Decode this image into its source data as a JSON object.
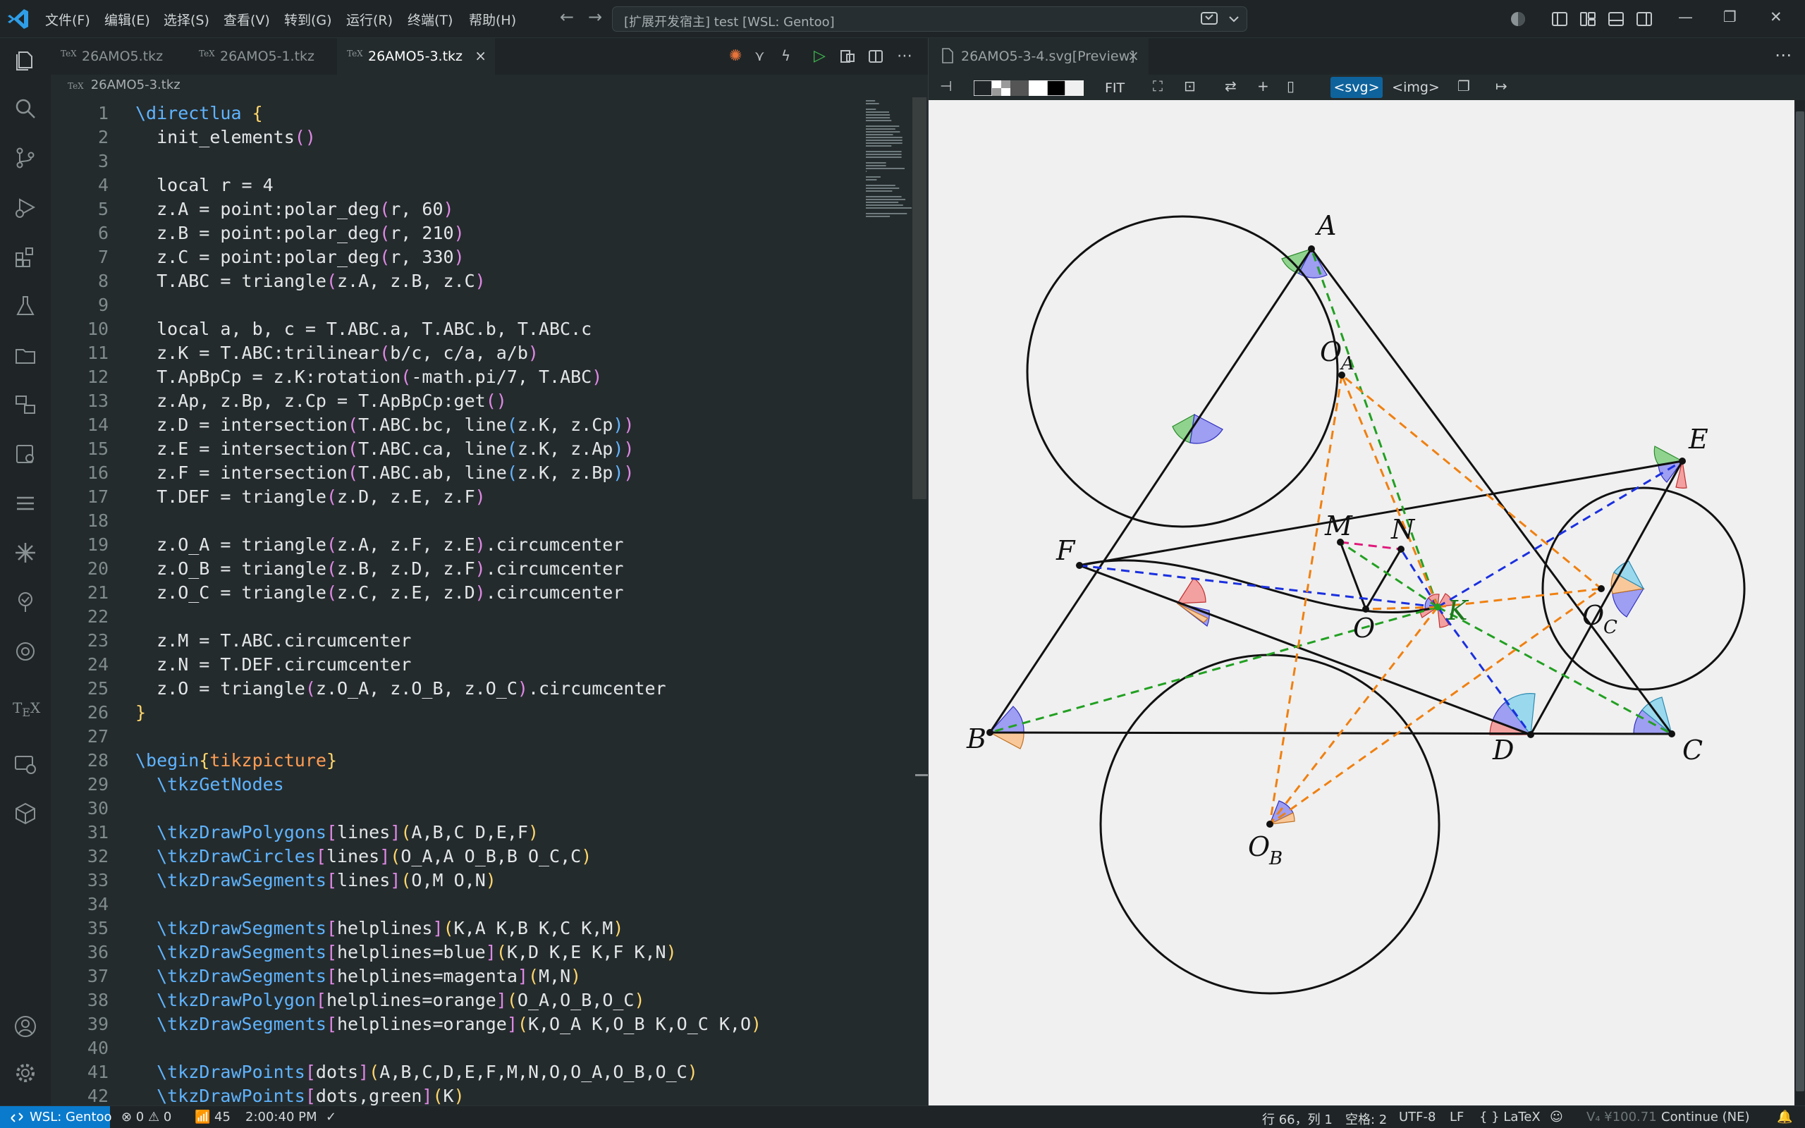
{
  "titlebar": {
    "menus": [
      "文件(F)",
      "编辑(E)",
      "选择(S)",
      "查看(V)",
      "转到(G)",
      "运行(R)",
      "终端(T)",
      "帮助(H)"
    ],
    "command_center": "[扩展开发宿主] test [WSL: Gentoo]"
  },
  "editor": {
    "tabs": [
      {
        "label": "26AMO5.tkz",
        "icon": "tex-file-icon"
      },
      {
        "label": "26AMO5-1.tkz",
        "icon": "tex-file-icon"
      },
      {
        "label": "26AMO5-3.tkz",
        "icon": "tex-file-icon",
        "active": true
      }
    ],
    "tab_icon_text": "TeX",
    "close_glyph": "×",
    "breadcrumb": "26AMO5-3.tkz",
    "lines": [
      {
        "n": "1",
        "html": "<span class=\"kw\">\\directlua</span> <span class=\"br1\">{</span>"
      },
      {
        "n": "2",
        "html": "  init_elements<span class=\"br2\">()</span>"
      },
      {
        "n": "3",
        "html": ""
      },
      {
        "n": "4",
        "html": "  local r = 4"
      },
      {
        "n": "5",
        "html": "  z.A = point:polar_deg<span class=\"br2\">(</span>r, 60<span class=\"br2\">)</span>"
      },
      {
        "n": "6",
        "html": "  z.B = point:polar_deg<span class=\"br2\">(</span>r, 210<span class=\"br2\">)</span>"
      },
      {
        "n": "7",
        "html": "  z.C = point:polar_deg<span class=\"br2\">(</span>r, 330<span class=\"br2\">)</span>"
      },
      {
        "n": "8",
        "html": "  T.ABC = triangle<span class=\"br2\">(</span>z.A, z.B, z.C<span class=\"br2\">)</span>"
      },
      {
        "n": "9",
        "html": ""
      },
      {
        "n": "10",
        "html": "  local a, b, c = T.ABC.a, T.ABC.b, T.ABC.c"
      },
      {
        "n": "11",
        "html": "  z.K = T.ABC:trilinear<span class=\"br2\">(</span>b/c, c/a, a/b<span class=\"br2\">)</span>"
      },
      {
        "n": "12",
        "html": "  T.ApBpCp = z.K:rotation<span class=\"br2\">(</span>-math.pi/7, T.ABC<span class=\"br2\">)</span>"
      },
      {
        "n": "13",
        "html": "  z.Ap, z.Bp, z.Cp = T.ApBpCp:get<span class=\"br2\">()</span>"
      },
      {
        "n": "14",
        "html": "  z.D = intersection<span class=\"br2\">(</span>T.ABC.bc, line<span class=\"br3\">(</span>z.K, z.Cp<span class=\"br3\">)</span><span class=\"br2\">)</span>"
      },
      {
        "n": "15",
        "html": "  z.E = intersection<span class=\"br2\">(</span>T.ABC.ca, line<span class=\"br3\">(</span>z.K, z.Ap<span class=\"br3\">)</span><span class=\"br2\">)</span>"
      },
      {
        "n": "16",
        "html": "  z.F = intersection<span class=\"br2\">(</span>T.ABC.ab, line<span class=\"br3\">(</span>z.K, z.Bp<span class=\"br3\">)</span><span class=\"br2\">)</span>"
      },
      {
        "n": "17",
        "html": "  T.DEF = triangle<span class=\"br2\">(</span>z.D, z.E, z.F<span class=\"br2\">)</span>"
      },
      {
        "n": "18",
        "html": ""
      },
      {
        "n": "19",
        "html": "  z.O_A = triangle<span class=\"br2\">(</span>z.A, z.F, z.E<span class=\"br2\">)</span>.circumcenter"
      },
      {
        "n": "20",
        "html": "  z.O_B = triangle<span class=\"br2\">(</span>z.B, z.D, z.F<span class=\"br2\">)</span>.circumcenter"
      },
      {
        "n": "21",
        "html": "  z.O_C = triangle<span class=\"br2\">(</span>z.C, z.E, z.D<span class=\"br2\">)</span>.circumcenter"
      },
      {
        "n": "22",
        "html": ""
      },
      {
        "n": "23",
        "html": "  z.M = T.ABC.circumcenter"
      },
      {
        "n": "24",
        "html": "  z.N = T.DEF.circumcenter"
      },
      {
        "n": "25",
        "html": "  z.O = triangle<span class=\"br2\">(</span>z.O_A, z.O_B, z.O_C<span class=\"br2\">)</span>.circumcenter"
      },
      {
        "n": "26",
        "html": "<span class=\"br1\">}</span>"
      },
      {
        "n": "27",
        "html": ""
      },
      {
        "n": "28",
        "html": "<span class=\"kw\">\\begin</span><span class=\"br1\">{</span><span class=\"ornge\">tikzpicture</span><span class=\"br1\">}</span>"
      },
      {
        "n": "29",
        "html": "  <span class=\"kw\">\\tkzGetNodes</span>"
      },
      {
        "n": "30",
        "html": ""
      },
      {
        "n": "31",
        "html": "  <span class=\"kw\">\\tkzDrawPolygons</span><span class=\"br2\">[</span>lines<span class=\"br2\">]</span><span class=\"br1\">(</span>A,B,C D,E,F<span class=\"br1\">)</span>"
      },
      {
        "n": "32",
        "html": "  <span class=\"kw\">\\tkzDrawCircles</span><span class=\"br2\">[</span>lines<span class=\"br2\">]</span><span class=\"br1\">(</span>O_A,A O_B,B O_C,C<span class=\"br1\">)</span>"
      },
      {
        "n": "33",
        "html": "  <span class=\"kw\">\\tkzDrawSegments</span><span class=\"br2\">[</span>lines<span class=\"br2\">]</span><span class=\"br1\">(</span>O,M O,N<span class=\"br1\">)</span>"
      },
      {
        "n": "34",
        "html": ""
      },
      {
        "n": "35",
        "html": "  <span class=\"kw\">\\tkzDrawSegments</span><span class=\"br2\">[</span>helplines<span class=\"br2\">]</span><span class=\"br1\">(</span>K,A K,B K,C K,M<span class=\"br1\">)</span>"
      },
      {
        "n": "36",
        "html": "  <span class=\"kw\">\\tkzDrawSegments</span><span class=\"br2\">[</span>helplines=blue<span class=\"br2\">]</span><span class=\"br1\">(</span>K,D K,E K,F K,N<span class=\"br1\">)</span>"
      },
      {
        "n": "37",
        "html": "  <span class=\"kw\">\\tkzDrawSegments</span><span class=\"br2\">[</span>helplines=magenta<span class=\"br2\">]</span><span class=\"br1\">(</span>M,N<span class=\"br1\">)</span>"
      },
      {
        "n": "38",
        "html": "  <span class=\"kw\">\\tkzDrawPolygon</span><span class=\"br2\">[</span>helplines=orange<span class=\"br2\">]</span><span class=\"br1\">(</span>O_A,O_B,O_C<span class=\"br1\">)</span>"
      },
      {
        "n": "39",
        "html": "  <span class=\"kw\">\\tkzDrawSegments</span><span class=\"br2\">[</span>helplines=orange<span class=\"br2\">]</span><span class=\"br1\">(</span>K,O_A K,O_B K,O_C K,O<span class=\"br1\">)</span>"
      },
      {
        "n": "40",
        "html": ""
      },
      {
        "n": "41",
        "html": "  <span class=\"kw\">\\tkzDrawPoints</span><span class=\"br2\">[</span>dots<span class=\"br2\">]</span><span class=\"br1\">(</span>A,B,C,D,E,F,M,N,O,O_A,O_B,O_C<span class=\"br1\">)</span>"
      },
      {
        "n": "42",
        "html": "  <span class=\"kw\">\\tkzDrawPoints</span><span class=\"br2\">[</span>dots,green<span class=\"br2\">]</span><span class=\"br1\">(</span>K<span class=\"br1\">)</span>"
      }
    ]
  },
  "preview": {
    "tab_label": "26AMO5-3-4.svg[Preview]",
    "fit_label": "FIT",
    "svg_label": "<svg>",
    "img_label": "<img>",
    "points": {
      "A": "A",
      "B": "B",
      "C": "C",
      "D": "D",
      "E": "E",
      "F": "F",
      "M": "M",
      "N": "N",
      "O": "O",
      "K": "K",
      "OA": "O",
      "OA_sub": "A",
      "OB": "O",
      "OB_sub": "B",
      "OC": "O",
      "OC_sub": "C"
    }
  },
  "statusbar": {
    "remote": "WSL: Gentoo",
    "problems": "⊗ 0 ⚠ 0",
    "ports": "45",
    "time": "2:00:40 PM",
    "check": "✓",
    "cursor": "行 66，列 1",
    "spaces": "空格: 2",
    "encoding": "UTF-8",
    "eol": "LF",
    "language": "{ } LaTeX",
    "extension_version": "V₄ ¥100.71",
    "continue": "Continue (NE)"
  },
  "colors": {
    "accent_blue": "#0e639c",
    "remote_blue": "#0a7acc",
    "run_green": "#3fb950",
    "spark_orange": "#e8743b"
  }
}
